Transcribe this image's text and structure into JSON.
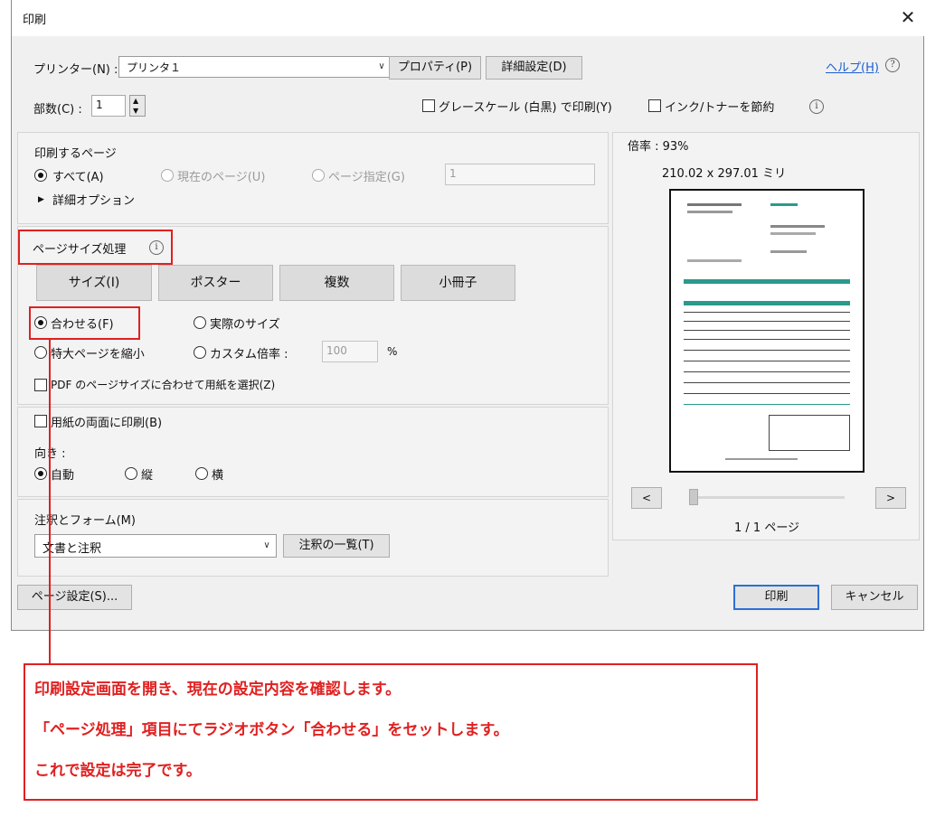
{
  "window": {
    "title": "印刷",
    "close_glyph": "✕"
  },
  "printer": {
    "label": "プリンター(N) :",
    "selected": "プリンタ１",
    "properties_label": "プロパティ(P)",
    "advanced_label": "詳細設定(D)",
    "help_label": "ヘルプ(H)",
    "help_glyph": "?"
  },
  "copies": {
    "label": "部数(C) :",
    "value": "1",
    "up_glyph": "▲",
    "down_glyph": "▼"
  },
  "options": {
    "grayscale_label": "グレースケール (白黒) で印刷(Y)",
    "ink_save_label": "インク/トナーを節約"
  },
  "pages_section": {
    "title": "印刷するページ",
    "all_label": "すべて(A)",
    "current_label": "現在のページ(U)",
    "range_label": "ページ指定(G)",
    "range_value": "1",
    "more_options_label": "詳細オプション",
    "more_options_glyph": "▶"
  },
  "size_section": {
    "title": "ページサイズ処理",
    "tabs": [
      "サイズ(I)",
      "ポスター",
      "複数",
      "小冊子"
    ],
    "fit_label": "合わせる(F)",
    "actual_label": "実際のサイズ",
    "shrink_label": "特大ページを縮小",
    "custom_label": "カスタム倍率 :",
    "custom_value": "100",
    "percent": "%",
    "pdf_paper_label": "PDF のページサイズに合わせて用紙を選択(Z)"
  },
  "duplex_section": {
    "duplex_label": "用紙の両面に印刷(B)",
    "orientation_label": "向き :",
    "auto_label": "自動",
    "portrait_label": "縦",
    "landscape_label": "横"
  },
  "comments_section": {
    "title": "注釈とフォーム(M)",
    "selected": "文書と注釈",
    "summarize_label": "注釈の一覧(T)"
  },
  "preview": {
    "scale_label": "倍率 : 93%",
    "size_label": "210.02 x 297.01 ミリ",
    "prev_glyph": "<",
    "next_glyph": ">",
    "page_indicator": "1 / 1 ページ"
  },
  "footer": {
    "page_setup_label": "ページ設定(S)...",
    "print_label": "印刷",
    "cancel_label": "キャンセル"
  },
  "annotation": {
    "line1": "印刷設定画面を開き、現在の設定内容を確認します。",
    "line2": "「ページ処理」項目にてラジオボタン「合わせる」をセットします。",
    "line3": "これで設定は完了です。"
  },
  "icons": {
    "info": "i",
    "dropdown": "∨"
  },
  "colors": {
    "highlight_red": "#e02020",
    "link_blue": "#1a5fd0",
    "preview_teal": "#2a9a8c"
  }
}
